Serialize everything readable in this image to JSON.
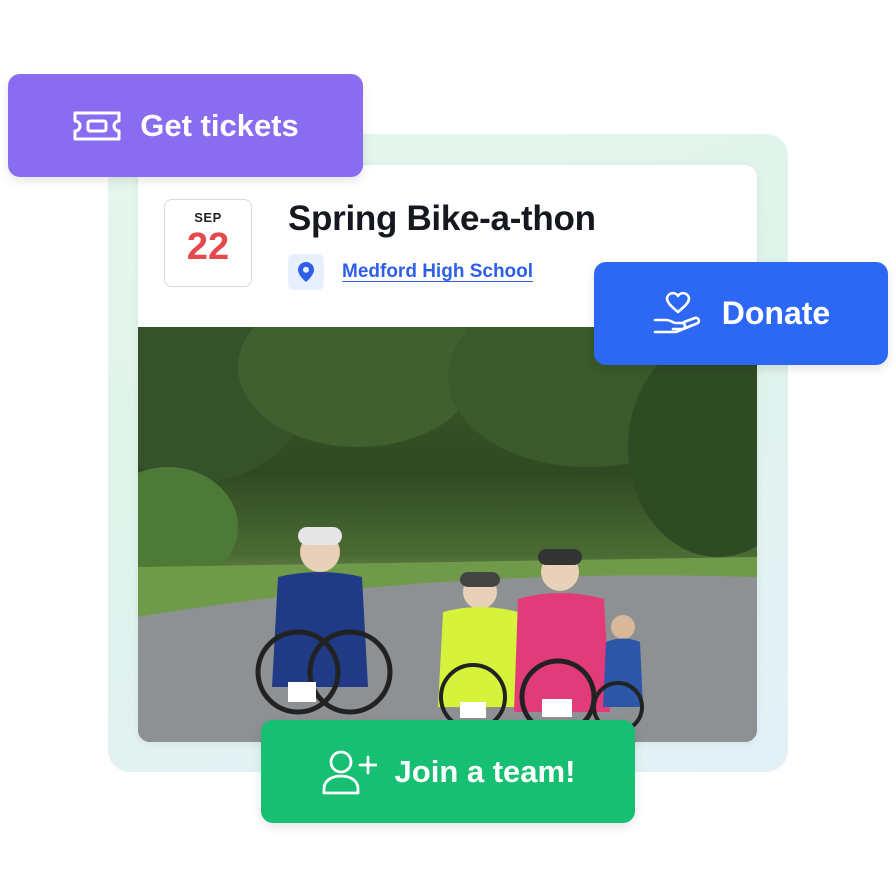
{
  "event": {
    "month": "SEP",
    "day": "22",
    "title": "Spring Bike-a-thon",
    "location": "Medford High School"
  },
  "actions": {
    "tickets_label": "Get tickets",
    "donate_label": "Donate",
    "team_label": "Join a team!"
  },
  "colors": {
    "tickets": "#8a6cf0",
    "donate": "#2d68f5",
    "team": "#16bf72",
    "date_day": "#e5484d",
    "link": "#2f5fe8"
  },
  "icons": {
    "tickets": "ticket-icon",
    "location": "location-pin-icon",
    "donate": "heart-hand-icon",
    "team": "add-user-icon"
  }
}
